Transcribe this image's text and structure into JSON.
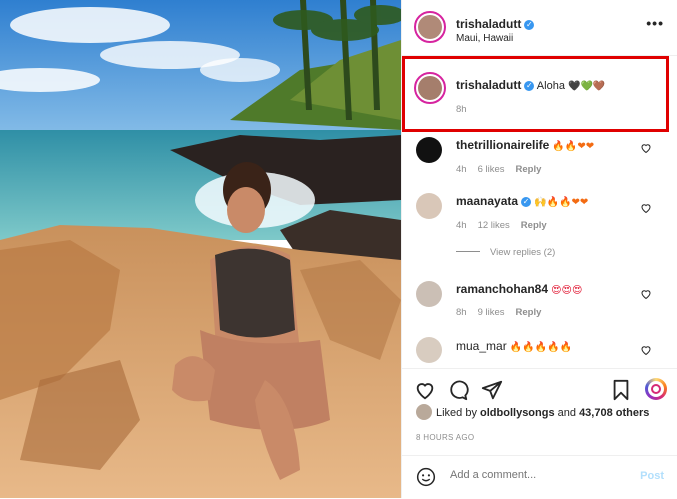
{
  "post": {
    "username": "trishaladutt",
    "location": "Maui, Hawaii",
    "more_label": "•••"
  },
  "caption": {
    "username": "trishaladutt",
    "text": "Aloha",
    "emojis": "🖤💚🤎",
    "time": "8h"
  },
  "comments": [
    {
      "username": "thetrillionairelife",
      "emojis": "🔥🔥❤❤",
      "time": "4h",
      "likes": "6 likes",
      "reply": "Reply",
      "verified": false
    },
    {
      "username": "maanayata",
      "emojis": "🙌🔥🔥❤❤",
      "time": "4h",
      "likes": "12 likes",
      "reply": "Reply",
      "verified": true
    },
    {
      "username": "ramanchohan84",
      "emojis": "😍😍😍",
      "time": "8h",
      "likes": "9 likes",
      "reply": "Reply",
      "verified": false
    },
    {
      "username": "mua_mar",
      "emojis": "🔥🔥🔥🔥🔥",
      "time": "",
      "likes": "",
      "reply": "",
      "verified": false
    }
  ],
  "view_replies": "View replies (2)",
  "likes_text": {
    "prefix": "Liked by ",
    "user": "oldbollysongs",
    "middle": " and ",
    "count": "43,708 others"
  },
  "time_ago": "8 HOURS AGO",
  "add_comment": {
    "placeholder": "Add a comment...",
    "post_label": "Post"
  },
  "colors": {
    "highlight_border": "#e00000",
    "verified": "#3897f0",
    "link_disabled": "#b2dffc"
  }
}
